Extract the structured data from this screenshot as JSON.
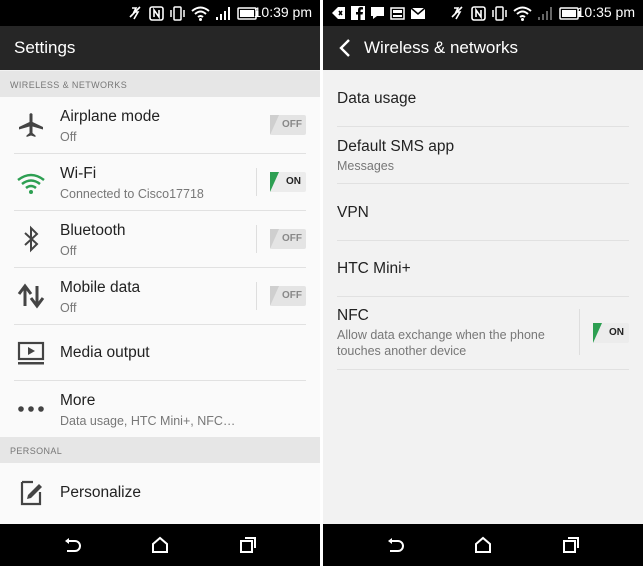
{
  "left_screen": {
    "status_time": "10:39 pm",
    "title": "Settings",
    "sections": [
      {
        "header": "WIRELESS & NETWORKS"
      },
      {
        "header": "PERSONAL"
      }
    ],
    "items": [
      {
        "title": "Airplane mode",
        "subtitle": "Off",
        "icon": "airplane-icon",
        "toggle": "OFF"
      },
      {
        "title": "Wi-Fi",
        "subtitle": "Connected to Cisco17718",
        "icon": "wifi-icon",
        "toggle": "ON"
      },
      {
        "title": "Bluetooth",
        "subtitle": "Off",
        "icon": "bluetooth-icon",
        "toggle": "OFF"
      },
      {
        "title": "Mobile data",
        "subtitle": "Off",
        "icon": "mobile-data-icon",
        "toggle": "OFF"
      },
      {
        "title": "Media output",
        "subtitle": "",
        "icon": "media-output-icon"
      },
      {
        "title": "More",
        "subtitle": "Data usage, HTC Mini+, NFC…",
        "icon": "more-icon"
      },
      {
        "title": "Personalize",
        "subtitle": "",
        "icon": "personalize-icon"
      }
    ]
  },
  "right_screen": {
    "status_time": "10:35 pm",
    "title": "Wireless & networks",
    "items": [
      {
        "title": "Data usage",
        "subtitle": ""
      },
      {
        "title": "Default SMS app",
        "subtitle": "Messages"
      },
      {
        "title": "VPN",
        "subtitle": ""
      },
      {
        "title": "HTC Mini+",
        "subtitle": ""
      },
      {
        "title": "NFC",
        "subtitle": "Allow data exchange when the phone",
        "subtitle2": "touches another device",
        "toggle": "ON"
      }
    ]
  },
  "colors": {
    "accent_green": "#2d9f52",
    "app_bar": "#262626",
    "background": "#f2f2f2"
  }
}
